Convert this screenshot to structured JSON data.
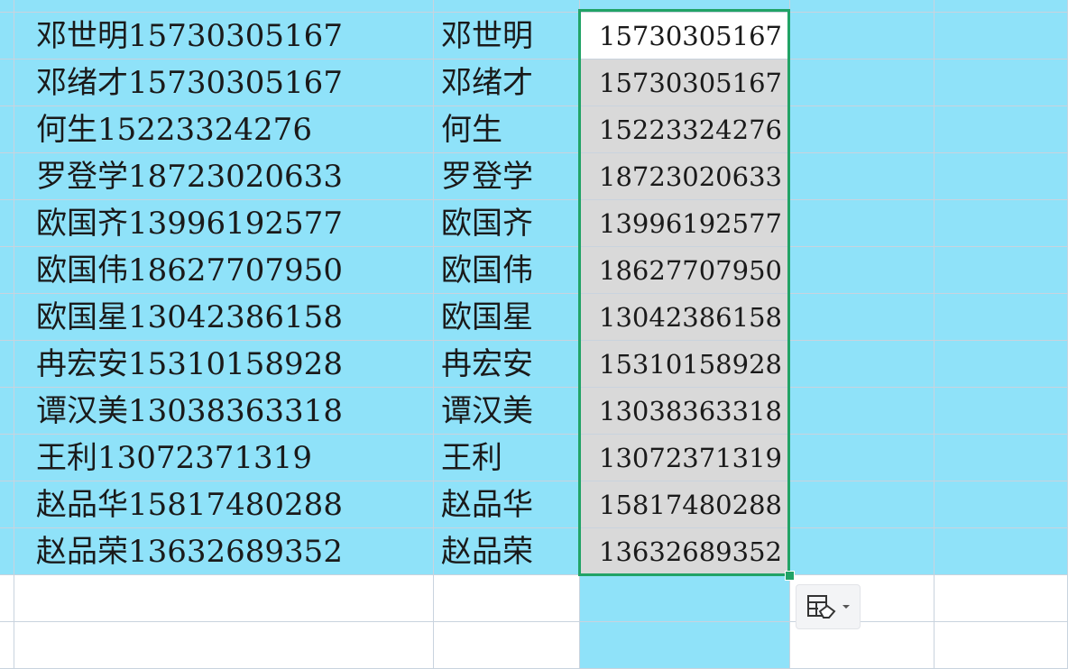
{
  "sheet": {
    "rows": [
      {
        "combined": "邓世明15730305167",
        "name": "邓世明",
        "phone": "15730305167"
      },
      {
        "combined": "邓绪才15730305167",
        "name": "邓绪才",
        "phone": "15730305167"
      },
      {
        "combined": "何生15223324276",
        "name": "何生",
        "phone": "15223324276"
      },
      {
        "combined": "罗登学18723020633",
        "name": "罗登学",
        "phone": "18723020633"
      },
      {
        "combined": "欧国齐13996192577",
        "name": "欧国齐",
        "phone": "13996192577"
      },
      {
        "combined": "欧国伟18627707950",
        "name": "欧国伟",
        "phone": "18627707950"
      },
      {
        "combined": "欧国星13042386158",
        "name": "欧国星",
        "phone": "13042386158"
      },
      {
        "combined": "冉宏安15310158928",
        "name": "冉宏安",
        "phone": "15310158928"
      },
      {
        "combined": "谭汉美13038363318",
        "name": "谭汉美",
        "phone": "13038363318"
      },
      {
        "combined": "王利13072371319",
        "name": "王利",
        "phone": "13072371319"
      },
      {
        "combined": "赵品华15817480288",
        "name": "赵品华",
        "phone": "15817480288"
      },
      {
        "combined": "赵品荣13632689352",
        "name": "赵品荣",
        "phone": "13632689352"
      }
    ]
  },
  "colors": {
    "highlight_fill": "#8fe2f9",
    "selection_fill": "#d9d9d9",
    "selection_border": "#21a366",
    "gridline": "#c9d3de"
  },
  "icons": {
    "paste_options": "paste-options-icon",
    "dropdown": "chevron-down-icon"
  }
}
